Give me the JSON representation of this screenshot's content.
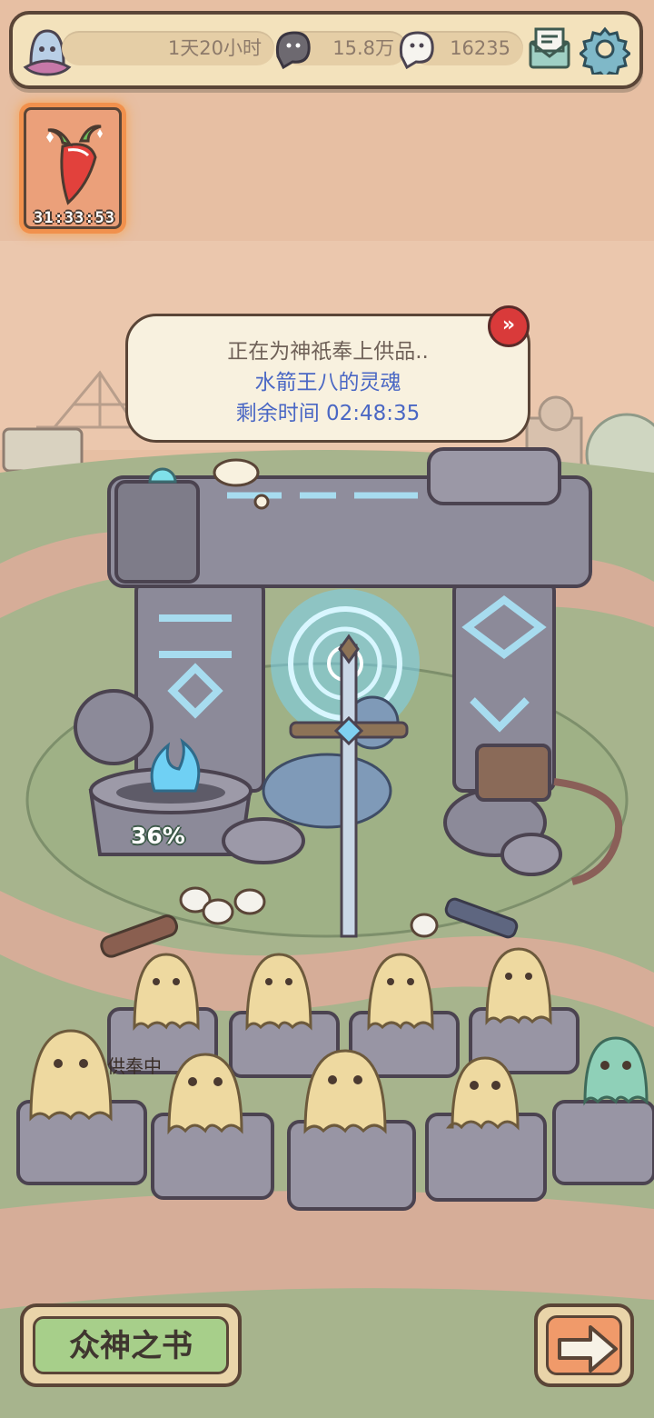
{
  "topbar": {
    "countdown": "1天20小时",
    "dark_soul_count": "15.8万",
    "white_soul_count": "16235"
  },
  "event": {
    "timer": "31:33:53"
  },
  "offering": {
    "status": "正在为神祇奉上供品..",
    "item_name": "水箭王八的灵魂",
    "remaining": "剩余时间  02:48:35"
  },
  "altar": {
    "progress": "36%",
    "worshipping_label": "供奉中"
  },
  "bottom": {
    "book_label": "众神之书"
  },
  "colors": {
    "accent_blue": "#4a67c4",
    "frame_brown": "#5a4537",
    "button_green": "#a7cf8a",
    "button_orange": "#f09a6a",
    "skip_red": "#d93a3a"
  }
}
